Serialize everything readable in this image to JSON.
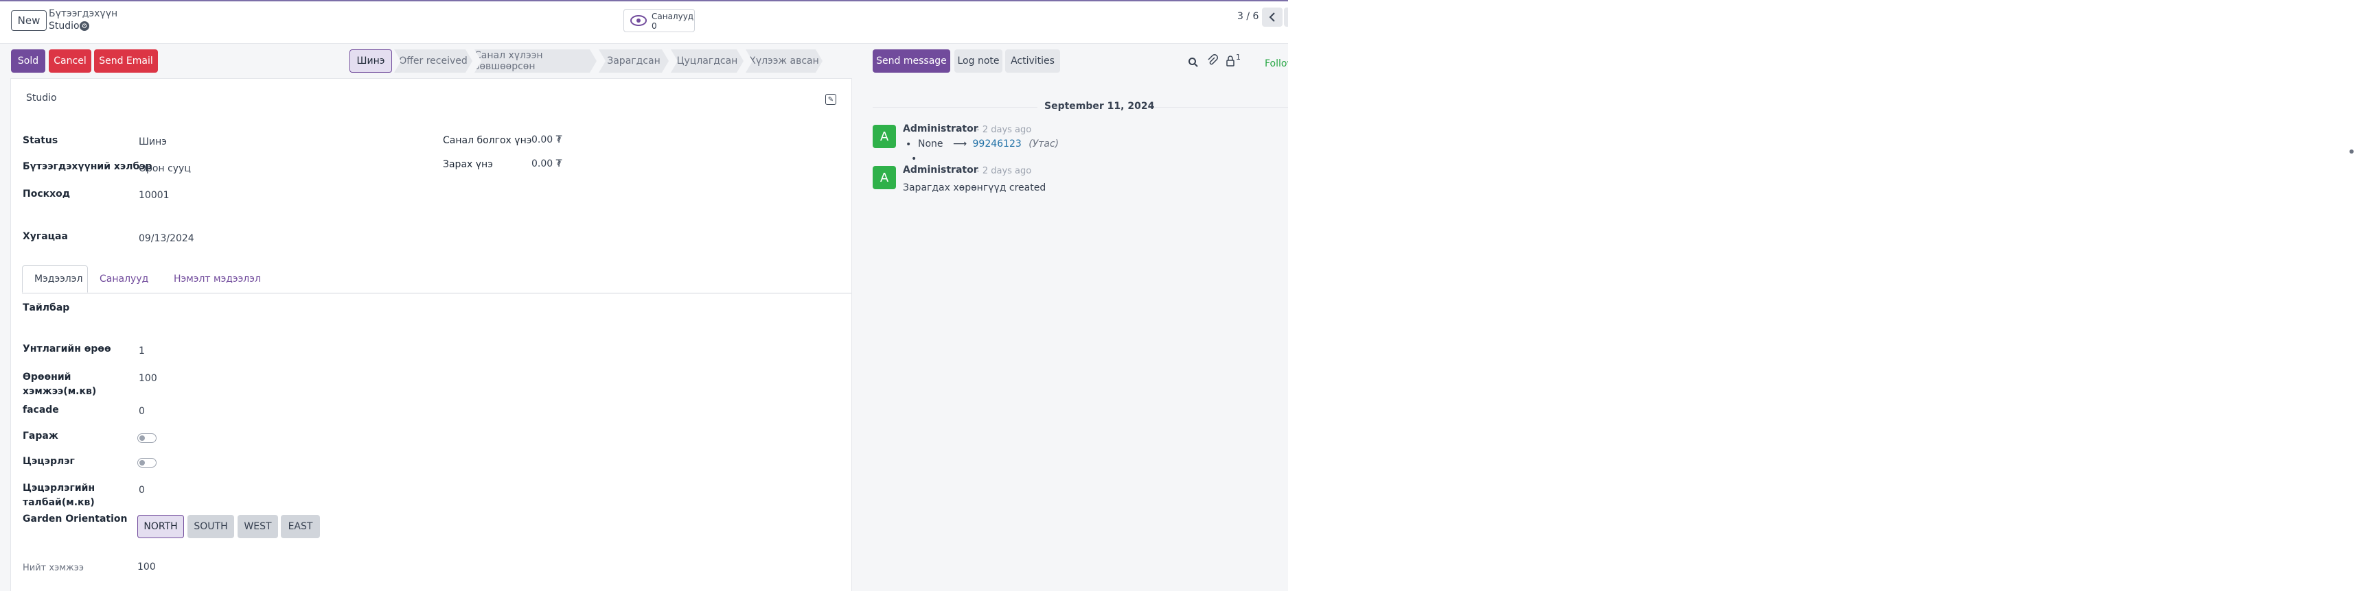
{
  "control_panel": {
    "new_label": "New",
    "breadcrumb_parent": "Бүтээгдэхүүн",
    "breadcrumb_current": "Studio",
    "smart_button": {
      "label": "Саналууд",
      "value": "0"
    },
    "pager": "3 / 6"
  },
  "status_bar": {
    "buttons": {
      "sold": "Sold",
      "cancel": "Cancel",
      "send_email": "Send Email"
    },
    "stages": [
      "Шинэ",
      "Offer received",
      "Санал хүлээн зөвшөөрсөн",
      "Зарагдсан",
      "Цуцлагдсан",
      "Хүлээж авсан"
    ],
    "active_stage": "Шинэ"
  },
  "chatter_bar": {
    "send_message": "Send message",
    "log_note": "Log note",
    "activities": "Activities",
    "followers_count": "1",
    "follow": "Follow"
  },
  "form": {
    "studio_label": "Studio",
    "fields_left": [
      {
        "label": "Status",
        "value": "Шинэ"
      },
      {
        "label": "Бүтээгдэхүүний хэлбэр",
        "value": "Орон сууц"
      },
      {
        "label": "Поскход",
        "value": "10001"
      },
      {
        "label": "Хугацаа",
        "value": "09/13/2024"
      }
    ],
    "fields_right": [
      {
        "label": "Санал болгох үнэ",
        "value": "0.00 ₮"
      },
      {
        "label": "Зарах үнэ",
        "value": "0.00 ₮"
      }
    ],
    "tabs": [
      "Мэдээлэл",
      "Саналууд",
      "Нэмэлт мэдээлэл"
    ],
    "active_tab": "Мэдээлэл",
    "details": {
      "description_label": "Тайлбар",
      "rooms": {
        "label": "Унтлагийн өрөө",
        "value": "1"
      },
      "living_area": {
        "label": "Өрөөний хэмжээ(м.кв)",
        "value": "100"
      },
      "facade": {
        "label": "facade",
        "value": "0"
      },
      "garage": {
        "label": "Гараж",
        "checked": false
      },
      "garden": {
        "label": "Цэцэрлэг",
        "checked": false
      },
      "garden_area": {
        "label": "Цэцэрлэгийн талбай(м.кв)",
        "value": "0"
      },
      "orientation": {
        "label": "Garden Orientation",
        "options": [
          "NORTH",
          "SOUTH",
          "WEST",
          "EAST"
        ],
        "selected": "NORTH"
      },
      "total_area": {
        "label": "Нийт хэмжээ",
        "value": "100"
      }
    }
  },
  "chatter": {
    "date": "September 11, 2024",
    "messages": [
      {
        "avatar": "A",
        "author": "Administrator",
        "ago": "- 2 days ago",
        "old_value": "None",
        "arrow": "⟶",
        "new_value": "99246123",
        "field": "(Утас)"
      },
      {
        "avatar": "A",
        "author": "Administrator",
        "ago": "- 2 days ago",
        "body": "Зарагдах хөрөнгүүд created"
      }
    ]
  },
  "colors": {
    "primary": "#714b9c",
    "danger": "#dc3545",
    "avatar": "#2fb14a",
    "follow": "#28a745"
  }
}
